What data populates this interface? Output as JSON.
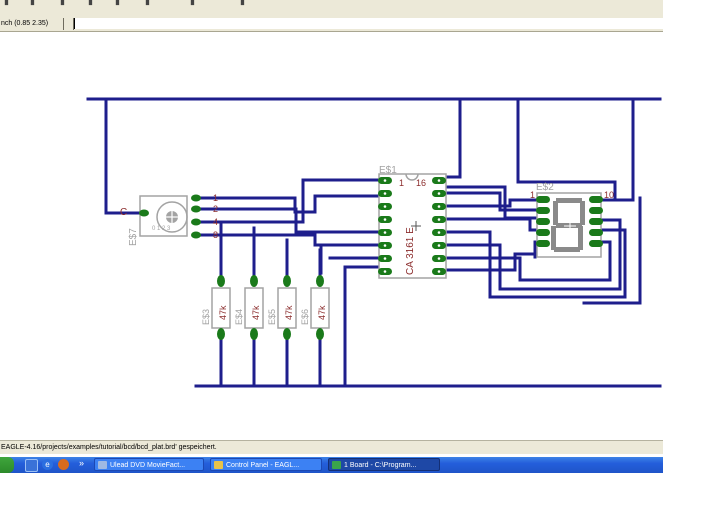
{
  "coordinate_display": "nch (0.85 2.35)",
  "command_line": {
    "value": ""
  },
  "status": {
    "message": "EAGLE-4.16/projects/examples/tutorial/bcd/bcd_plat.brd' gespeichert."
  },
  "board": {
    "rotary_switch": {
      "name": "E$7",
      "pin_labels": [
        "1",
        "2",
        "4",
        "8"
      ],
      "common_label": "C"
    },
    "counter_ic": {
      "name": "E$1",
      "part_text": "CA 3161 E",
      "pin1_label": "1",
      "pin16_label": "16"
    },
    "display": {
      "name": "E$2",
      "pin1_label": "1",
      "pin10_label": "10"
    },
    "resistors": [
      {
        "name": "E$3",
        "value": "47k"
      },
      {
        "name": "E$4",
        "value": "47k"
      },
      {
        "name": "E$5",
        "value": "47k"
      },
      {
        "name": "E$6",
        "value": "47k"
      }
    ],
    "colors": {
      "trace": "#1e1e8c",
      "pad": "#1a7a1a",
      "outline": "#a3a3a3",
      "label": "#8b2c2c"
    }
  },
  "taskbar": {
    "tasks": [
      {
        "label": "Ulead DVD MovieFact...",
        "active": false
      },
      {
        "label": "Control Panel - EAGL...",
        "active": false
      },
      {
        "label": "1 Board - C:\\Program...",
        "active": true
      }
    ]
  }
}
